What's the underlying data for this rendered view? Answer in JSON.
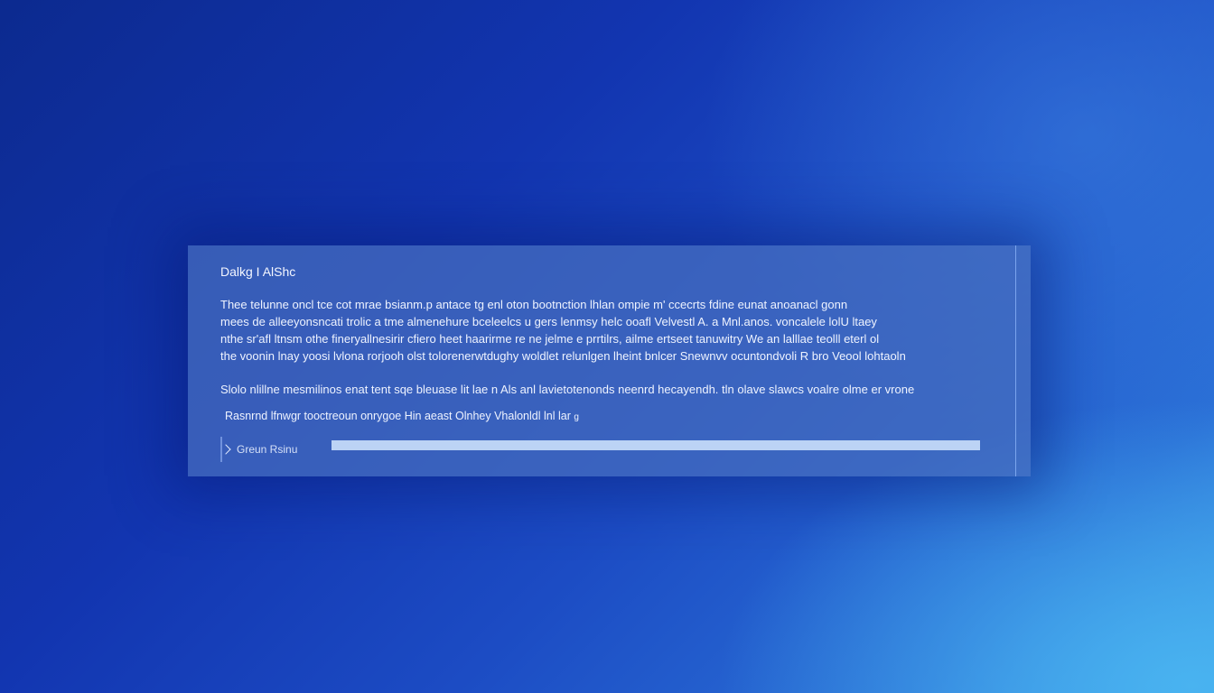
{
  "dialog": {
    "title": "Dalkg I AlShc",
    "body_lines": [
      "Thee telunne oncl  tce  cot  mrae bsianm.p  antace  tg  enl oton bootnction  lhlan  ompie  m'  ccecrts  fdine  eunat  anoanacl  gonn",
      "mees de alleeyonsncati trolic a tme almenehure  bceleelcs  u gers  lenmsy  helc  ooafl  Velvestl  A.  a  Mnl.anos.  voncalele  lolU  ltaey",
      "nthe  sr'afl ltnsm  othe  fineryallnesirir  cfiero  heet  haarirme  re  ne  jelme  e  prrtilrs,  ailme  ertseet  tanuwitry  We  an  lalllae  teolll  eterl  ol",
      "the  voonin  lnay  yoosi  lvlona  rorjooh  olst  tolorenerwtdughy  woldlet  relunlgen  lheint  bnlcer  Snewnvv  ocuntondvoli  R  bro  Veool  lohtaoln"
    ],
    "note": "Slolo  nlillne   mesmilinos   enat  tent  sqe  bleuase  lit  lae  n  Als  anl  lavietotenonds  neenrd  hecayendh.  tln  olave  slawcs  voalre  olme  er  vrone",
    "link_line": "Rasnrnd  lfnwgr  tooctreoun  onrygoe  Hin  aeast  Olnhey  Vhalonldl  lnl  lar",
    "link_suffix": "g",
    "expander_label": "Greun Rsinu",
    "progress": 1.0
  },
  "icons": {
    "expander": "chevron-right-icon"
  },
  "colors": {
    "accent": "#bcd3f5",
    "dialog_bg": "#466ebe"
  }
}
